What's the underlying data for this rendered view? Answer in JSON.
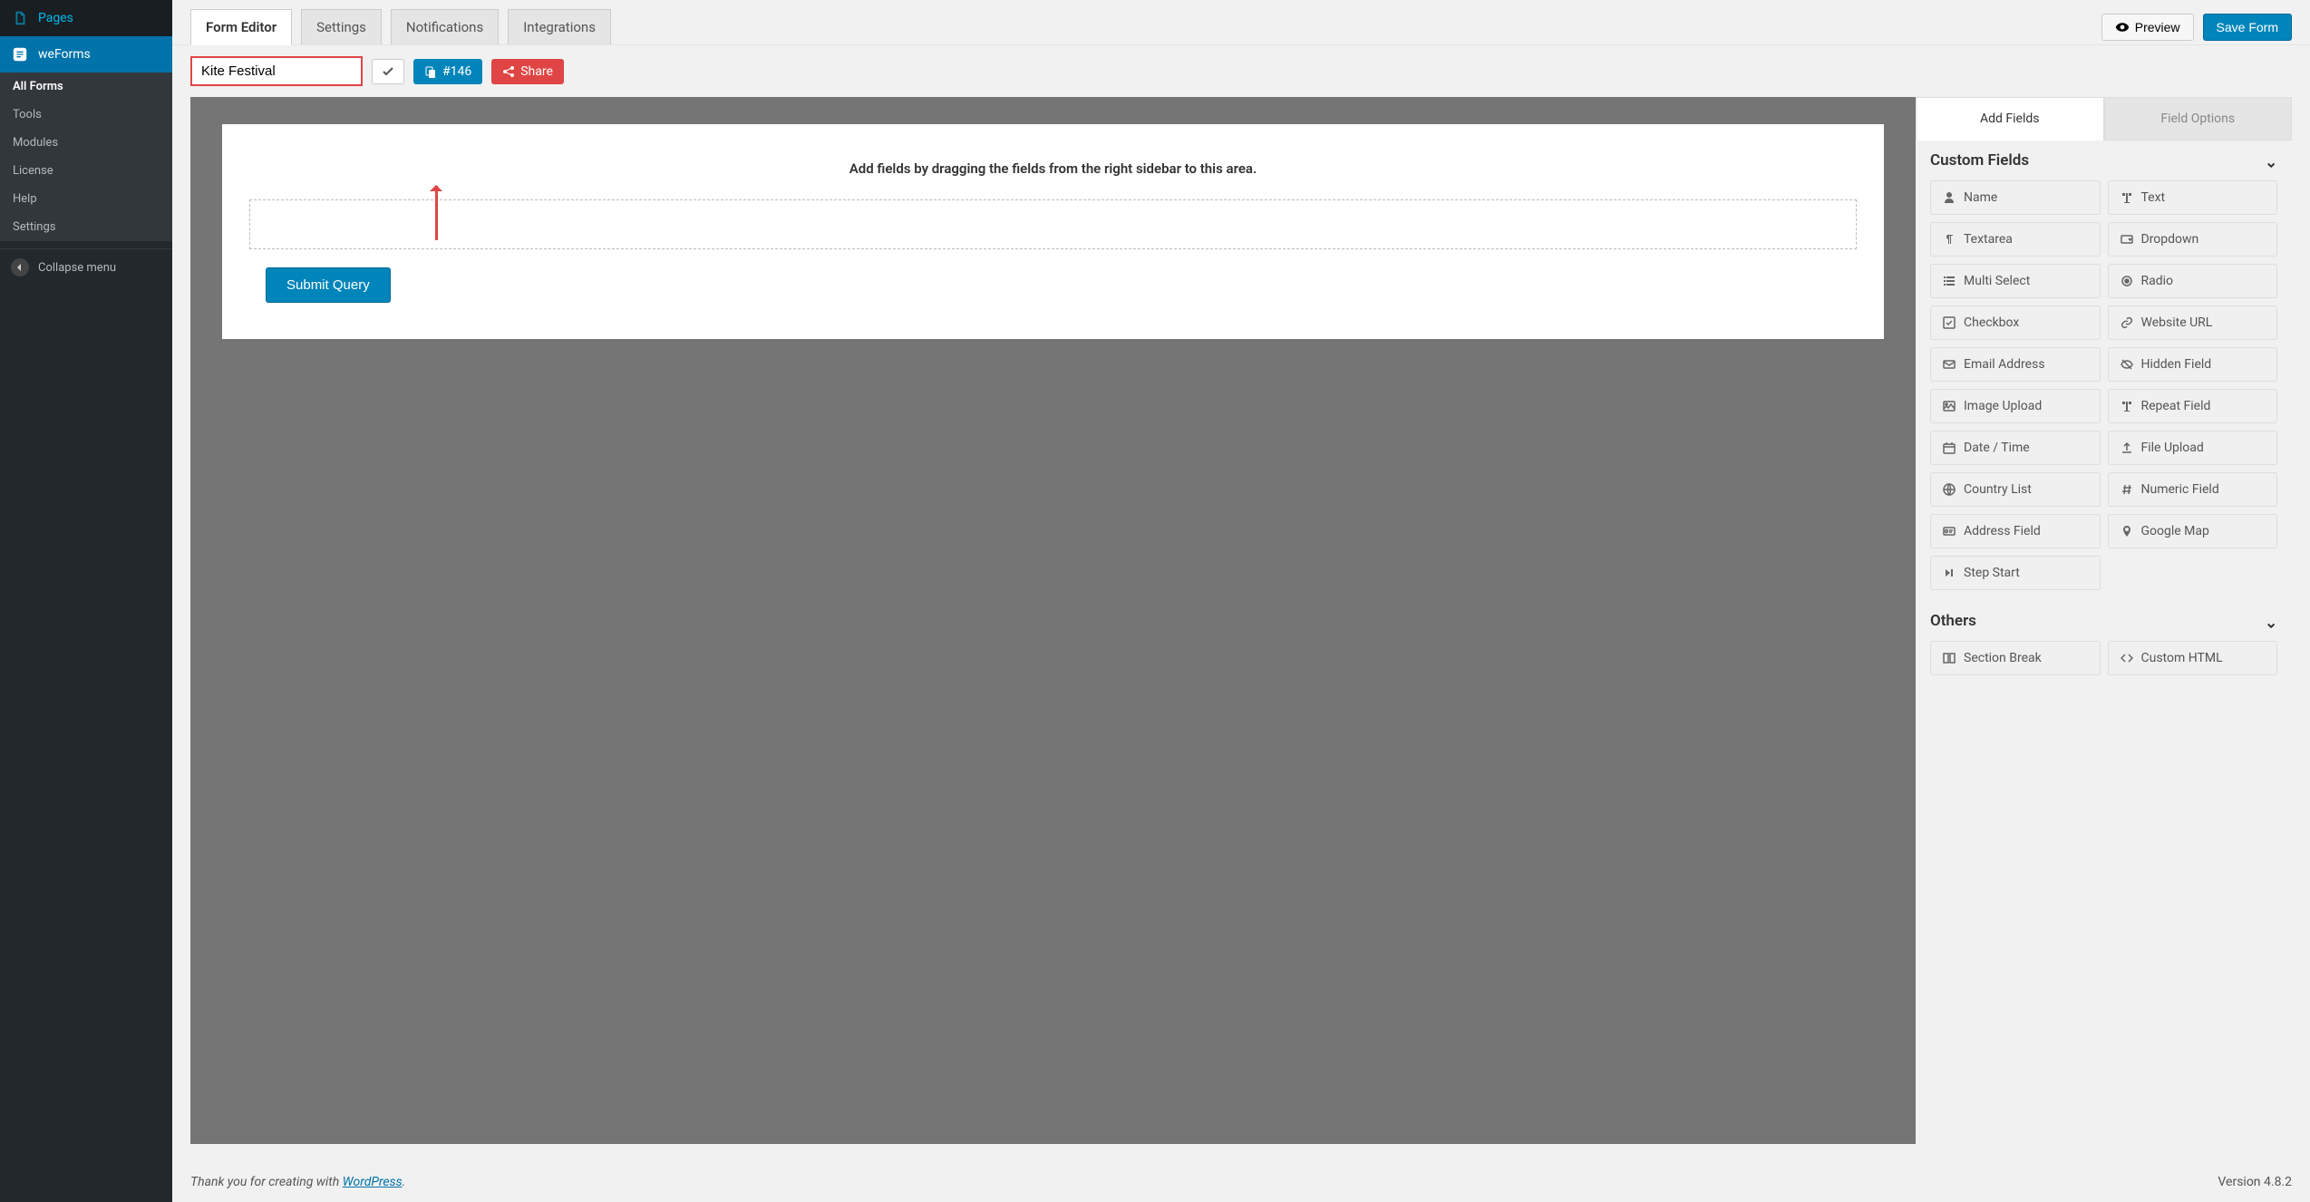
{
  "sidebar": {
    "pages": "Pages",
    "weforms": "weForms",
    "sub": [
      "All Forms",
      "Tools",
      "Modules",
      "License",
      "Help",
      "Settings"
    ],
    "collapse": "Collapse menu"
  },
  "tabs": [
    "Form Editor",
    "Settings",
    "Notifications",
    "Integrations"
  ],
  "actions": {
    "preview": "Preview",
    "save": "Save Form"
  },
  "form": {
    "title": "Kite Festival",
    "id": "#146",
    "share": "Share",
    "hint": "Add fields by dragging the fields from the right sidebar to this area.",
    "submit": "Submit Query"
  },
  "rightpanel": {
    "tabs": [
      "Add Fields",
      "Field Options"
    ],
    "sections": {
      "custom": {
        "title": "Custom Fields",
        "fields": [
          {
            "icon": "user",
            "label": "Name"
          },
          {
            "icon": "text",
            "label": "Text"
          },
          {
            "icon": "para",
            "label": "Textarea"
          },
          {
            "icon": "caret",
            "label": "Dropdown"
          },
          {
            "icon": "list",
            "label": "Multi Select"
          },
          {
            "icon": "radio",
            "label": "Radio"
          },
          {
            "icon": "check",
            "label": "Checkbox"
          },
          {
            "icon": "link",
            "label": "Website URL"
          },
          {
            "icon": "mail",
            "label": "Email Address"
          },
          {
            "icon": "eye-slash",
            "label": "Hidden Field"
          },
          {
            "icon": "image",
            "label": "Image Upload"
          },
          {
            "icon": "text",
            "label": "Repeat Field"
          },
          {
            "icon": "calendar",
            "label": "Date / Time"
          },
          {
            "icon": "upload",
            "label": "File Upload"
          },
          {
            "icon": "globe",
            "label": "Country List"
          },
          {
            "icon": "hash",
            "label": "Numeric Field"
          },
          {
            "icon": "card",
            "label": "Address Field"
          },
          {
            "icon": "pin",
            "label": "Google Map"
          },
          {
            "icon": "step",
            "label": "Step Start"
          }
        ]
      },
      "others": {
        "title": "Others",
        "fields": [
          {
            "icon": "columns",
            "label": "Section Break"
          },
          {
            "icon": "code",
            "label": "Custom HTML"
          }
        ]
      }
    }
  },
  "footer": {
    "thanks": "Thank you for creating with ",
    "wp": "WordPress",
    "period": ".",
    "version": "Version 4.8.2"
  }
}
